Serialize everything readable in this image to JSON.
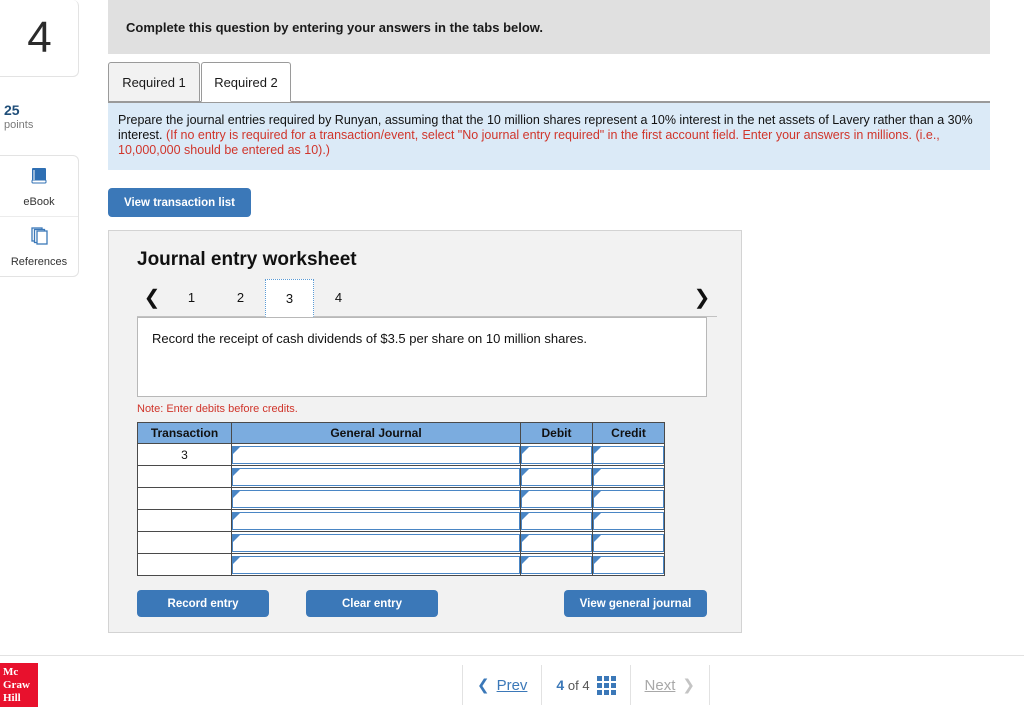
{
  "left_rail": {
    "question_number": "4",
    "points_value": "25",
    "points_label": "points",
    "tools": [
      {
        "label": "eBook",
        "icon": "book-icon"
      },
      {
        "label": "References",
        "icon": "pages-icon"
      }
    ]
  },
  "banner": {
    "text": "Complete this question by entering your answers in the tabs below."
  },
  "tabs": [
    {
      "label": "Required 1",
      "active": false
    },
    {
      "label": "Required 2",
      "active": true
    }
  ],
  "instructions": {
    "black_part": "Prepare the journal entries required by Runyan, assuming that the 10 million shares represent a 10% interest in the net assets of Lavery rather than a 30% interest.",
    "red_part": "(If no entry is required for a transaction/event, select \"No journal entry required\" in the first account field. Enter your answers in millions. (i.e., 10,000,000 should be entered as 10).)"
  },
  "toolbar": {
    "view_transaction_list": "View transaction list"
  },
  "worksheet": {
    "title": "Journal entry worksheet",
    "pager": {
      "prev_icon": "chevron-left-icon",
      "next_icon": "chevron-right-icon",
      "pages": [
        "1",
        "2",
        "3",
        "4"
      ],
      "selected": "3"
    },
    "prompt": "Record the receipt of cash dividends of $3.5 per share on 10 million shares.",
    "note": "Note: Enter debits before credits.",
    "table": {
      "headers": [
        "Transaction",
        "General Journal",
        "Debit",
        "Credit"
      ],
      "rows": [
        {
          "transaction": "3",
          "general_journal": "",
          "debit": "",
          "credit": ""
        },
        {
          "transaction": "",
          "general_journal": "",
          "debit": "",
          "credit": ""
        },
        {
          "transaction": "",
          "general_journal": "",
          "debit": "",
          "credit": ""
        },
        {
          "transaction": "",
          "general_journal": "",
          "debit": "",
          "credit": ""
        },
        {
          "transaction": "",
          "general_journal": "",
          "debit": "",
          "credit": ""
        },
        {
          "transaction": "",
          "general_journal": "",
          "debit": "",
          "credit": ""
        }
      ]
    },
    "buttons": {
      "record_entry": "Record entry",
      "clear_entry": "Clear entry",
      "view_general_journal": "View general journal"
    }
  },
  "footer": {
    "logo_lines": [
      "Mc",
      "Graw",
      "Hill"
    ],
    "prev_label": "Prev",
    "next_label": "Next",
    "current_page": "4",
    "of_label": "of",
    "total_pages": "4",
    "grid_icon": "grid-icon"
  },
  "colors": {
    "accent_blue": "#3b78b8",
    "table_header_blue": "#7bacdf",
    "instruction_bg": "#dbeaf7",
    "note_red": "#d0352b",
    "logo_red": "#e8112d"
  }
}
